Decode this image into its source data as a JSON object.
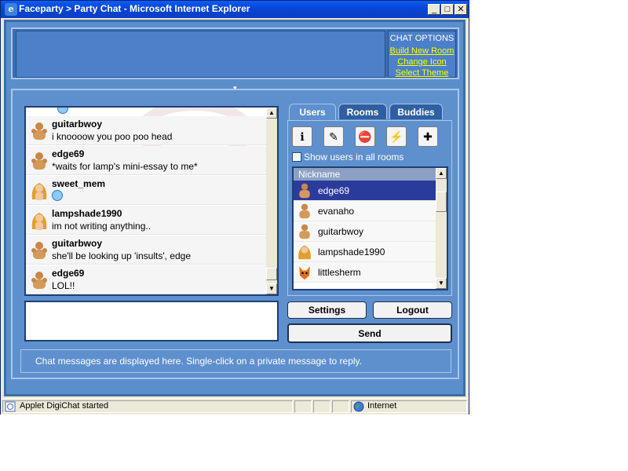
{
  "window": {
    "title": "Faceparty > Party Chat - Microsoft Internet Explorer",
    "minimize": "_",
    "maximize": "□",
    "close": "✕"
  },
  "chat_options": {
    "header": "CHAT OPTIONS",
    "links": [
      "Build New Room",
      "Change Icon",
      "Select Theme"
    ]
  },
  "messages": [
    {
      "nick": "guitarbwoy",
      "text": "i knoooow you poo poo head",
      "avatar": "muscle-man-icon"
    },
    {
      "nick": "edge69",
      "text": "*waits for lamp's mini-essay to me*",
      "avatar": "muscle-man-icon"
    },
    {
      "nick": "sweet_mem",
      "text": "",
      "avatar": "blonde-woman-icon",
      "emoticon": "smiley-icon"
    },
    {
      "nick": "lampshade1990",
      "text": "im not writing anything..",
      "avatar": "blonde-woman-icon"
    },
    {
      "nick": "guitarbwoy",
      "text": "she'll be looking up 'insults', edge",
      "avatar": "muscle-man-icon"
    },
    {
      "nick": "edge69",
      "text": "LOL!!",
      "avatar": "muscle-man-icon"
    }
  ],
  "tabs": [
    "Users",
    "Rooms",
    "Buddies"
  ],
  "show_all_rooms_label": "Show users in all rooms",
  "user_list": {
    "header": "Nickname",
    "users": [
      {
        "name": "edge69",
        "selected": true,
        "avatar": "muscle-man-icon"
      },
      {
        "name": "evanaho",
        "selected": false,
        "avatar": "muscle-man-icon"
      },
      {
        "name": "guitarbwoy",
        "selected": false,
        "avatar": "muscle-man-icon"
      },
      {
        "name": "lampshade1990",
        "selected": false,
        "avatar": "blonde-woman-icon"
      },
      {
        "name": "littlesherm",
        "selected": false,
        "avatar": "fox-icon"
      }
    ]
  },
  "buttons": {
    "settings": "Settings",
    "logout": "Logout",
    "send": "Send"
  },
  "status_message": "Chat messages are displayed here.  Single-click on a private message to reply.",
  "statusbar": {
    "applet": "Applet DigiChat started",
    "zone": "Internet"
  },
  "colors": {
    "panel": "#5e90ce",
    "link": "#ffff00",
    "selected_row": "#2b3b9b"
  }
}
